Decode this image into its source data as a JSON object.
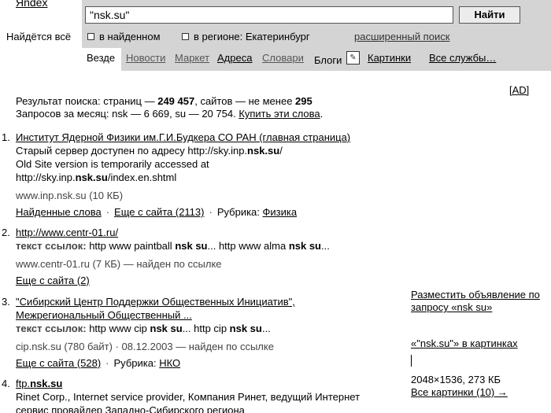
{
  "header": {
    "logo": "Яndex",
    "tagline": "Найдётся всё",
    "search_value": "\"nsk.su\"",
    "search_button": "Найти",
    "option_in_found": "в найденном",
    "option_in_region": "в регионе: Екатеринбург",
    "advanced_search": "расширенный поиск"
  },
  "nav": {
    "active": "Везде",
    "items": [
      "Новости",
      "Маркет",
      "Адреса",
      "Словари",
      "Блоги",
      "Картинки",
      "Все службы…"
    ]
  },
  "ad_link": "[AD]",
  "summary": {
    "line1_prefix": "Результат поиска: страниц — ",
    "pages": "249 457",
    "line1_mid": ", сайтов — не менее ",
    "sites": "295",
    "line2_prefix": "Запросов за месяц: nsk — 6 669, su — 20 754. ",
    "buy_words": "Купить эти слова"
  },
  "results": [
    {
      "num": "1.",
      "title": "Институт Ядерной Физики им.Г.И.Будкера СО РАН (главная страница)",
      "snippet1_a": "Старый сервер доступен по адресу http://sky.inp.",
      "snippet1_b": "nsk.su",
      "snippet1_c": "/",
      "snippet2": "Old Site version is temporarily accessed at",
      "snippet3_a": "http://sky.inp.",
      "snippet3_b": "nsk.su",
      "snippet3_c": "/index.en.shtml",
      "url_meta": "www.inp.nsk.su (10 КБ)",
      "link_found_words": "Найденные слова",
      "sep1": "·",
      "link_more": "Еще с сайта (2113)",
      "sep2": "·",
      "rubric_label": "Рубрика: ",
      "rubric": "Физика"
    },
    {
      "num": "2.",
      "title": "http://www.centr-01.ru/",
      "snip_label": "текст ссылок:",
      "snip_a": " http www paintball ",
      "snip_b": "nsk su",
      "snip_c": "... http www alma ",
      "snip_d": "nsk su",
      "snip_e": "...",
      "url_meta": "www.centr-01.ru (7 КБ) — найден по ссылке",
      "link_more": "Еще с сайта (2)"
    },
    {
      "num": "3.",
      "title_l1": "\"Сибирский Центр Поддержки Общественных Инициатив\",",
      "title_l2": "Межрегиональный Общественный ...",
      "snip_label": "текст ссылок:",
      "snip_a": " http www cip ",
      "snip_b": "nsk su",
      "snip_c": "... http cip ",
      "snip_d": "nsk su",
      "snip_e": "...",
      "url_meta": "cip.nsk.su (780 байт) · 08.12.2003 — найден по ссылке",
      "link_more": "Еще с сайта (528)",
      "sep1": "·",
      "rubric_label": "Рубрика: ",
      "rubric": "НКО"
    },
    {
      "num": "4.",
      "title_a": "ftp.",
      "title_b": "nsk.su",
      "snippet1": "Rinet Corp., Internet service provider, Компания Ринет, ведущий Интернет",
      "snippet2": "сервис провайдер Западно-Сибирского региона"
    }
  ],
  "right_column": {
    "post_ad_l1": "Разместить объявление по",
    "post_ad_l2": "запросу «nsk su»",
    "images_link": "«\"nsk.su\"» в картинках",
    "image_info": "2048×1536, 273 КБ",
    "all_images": "Все картинки (10) →"
  }
}
